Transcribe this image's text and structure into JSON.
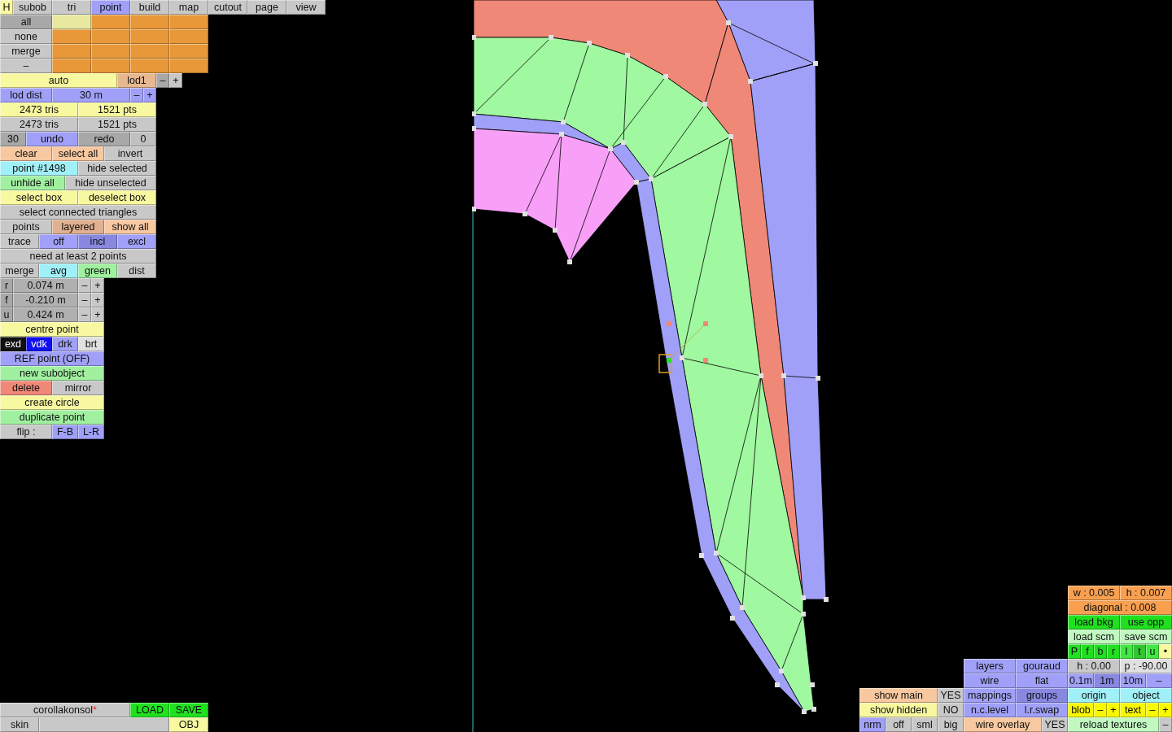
{
  "h_button": {
    "text": "H",
    "color": "#f8f8a0"
  },
  "tabs": [
    {
      "label": "subob",
      "selected": false
    },
    {
      "label": "tri",
      "selected": false
    },
    {
      "label": "point",
      "selected": true
    },
    {
      "label": "build",
      "selected": false
    },
    {
      "label": "map",
      "selected": false
    },
    {
      "label": "cutout",
      "selected": false
    },
    {
      "label": "page",
      "selected": false
    },
    {
      "label": "view",
      "selected": false
    }
  ],
  "left_rows": [
    [
      {
        "text": "all",
        "color": "#a8a8a8"
      },
      {
        "color": "#e8e8a0"
      },
      {
        "color": "#e89838"
      },
      {
        "color": "#e89838"
      },
      {
        "color": "#e89838"
      }
    ],
    [
      {
        "text": "none",
        "color": "#c8c8c8"
      },
      {
        "color": "#e89838"
      },
      {
        "color": "#e89838"
      },
      {
        "color": "#e89838"
      },
      {
        "color": "#e89838"
      }
    ],
    [
      {
        "text": "merge",
        "color": "#c8c8c8"
      },
      {
        "color": "#e89838"
      },
      {
        "color": "#e89838"
      },
      {
        "color": "#e89838"
      },
      {
        "color": "#e89838"
      }
    ],
    [
      {
        "text": "–",
        "color": "#c8c8c8"
      },
      {
        "color": "#e89838"
      },
      {
        "color": "#e89838"
      },
      {
        "color": "#e89838"
      },
      {
        "color": "#e89838"
      }
    ],
    [
      {
        "text": "auto",
        "color": "#f8f8a0"
      },
      {
        "text": "lod1",
        "color": "#e8b890"
      },
      {
        "text": "–",
        "color": "#a8a8a8"
      },
      {
        "text": "+",
        "color": "#c8c8c8"
      }
    ],
    [
      {
        "text": "lod dist",
        "color": "#a0a0f8"
      },
      {
        "text": "30 m",
        "color": "#a0a0f8"
      },
      {
        "text": "–",
        "color": "#a0a0f8"
      },
      {
        "text": "+",
        "color": "#a0a0f8"
      }
    ],
    [
      {
        "text": "2473 tris",
        "color": "#f8f8a0"
      },
      {
        "text": "1521 pts",
        "color": "#f8f8a0"
      }
    ],
    [
      {
        "text": "2473 tris",
        "color": "#c8c8c8"
      },
      {
        "text": "1521 pts",
        "color": "#c8c8c8"
      }
    ],
    [
      {
        "text": "30",
        "color": "#a8a8a8"
      },
      {
        "text": "undo",
        "color": "#a0a0f8"
      },
      {
        "text": "redo",
        "color": "#a8a8a8"
      },
      {
        "text": "0",
        "color": "#c0c0c0"
      }
    ],
    [
      {
        "text": "clear",
        "color": "#f8c8a0"
      },
      {
        "text": "select all",
        "color": "#f8c8a0"
      },
      {
        "text": "invert",
        "color": "#c8c8c8"
      }
    ],
    [
      {
        "text": "point #1498",
        "color": "#a0f0f8"
      },
      {
        "text": "hide selected",
        "color": "#c8c8c8"
      }
    ],
    [
      {
        "text": "unhide all",
        "color": "#a0f0a0"
      },
      {
        "text": "hide unselected",
        "color": "#c8c8c8"
      }
    ],
    [
      {
        "text": "select box",
        "color": "#f8f8a0"
      },
      {
        "text": "deselect box",
        "color": "#f8f8a0"
      }
    ],
    [
      {
        "text": "select connected triangles",
        "color": "#c8c8c8"
      }
    ],
    [
      {
        "text": "points",
        "color": "#c8c8c8"
      },
      {
        "text": "layered",
        "color": "#e0b090"
      },
      {
        "text": "show all",
        "color": "#f8c8a0"
      }
    ],
    [
      {
        "text": "trace",
        "color": "#c8c8c8"
      },
      {
        "text": "off",
        "color": "#a0a0f8"
      },
      {
        "text": "incl",
        "color": "#8888e0"
      },
      {
        "text": "excl",
        "color": "#a0a0f8"
      }
    ],
    [
      {
        "text": "need at least 2 points",
        "color": "#c8c8c8"
      }
    ],
    [
      {
        "text": "merge",
        "color": "#c8c8c8"
      },
      {
        "text": "avg",
        "color": "#a0f0f8"
      },
      {
        "text": "green",
        "color": "#a0f0a0"
      },
      {
        "text": "dist",
        "color": "#c8c8c8"
      }
    ],
    [
      {
        "text": "r",
        "color": "#a8a8a8"
      },
      {
        "text": "0.074 m",
        "color": "#b0b0b0"
      },
      {
        "text": "–",
        "color": "#c8c8c8"
      },
      {
        "text": "+",
        "color": "#c8c8c8"
      }
    ],
    [
      {
        "text": "f",
        "color": "#a8a8a8"
      },
      {
        "text": "-0.210 m",
        "color": "#b0b0b0"
      },
      {
        "text": "–",
        "color": "#c8c8c8"
      },
      {
        "text": "+",
        "color": "#c8c8c8"
      }
    ],
    [
      {
        "text": "u",
        "color": "#a8a8a8"
      },
      {
        "text": "0.424 m",
        "color": "#b0b0b0"
      },
      {
        "text": "–",
        "color": "#c8c8c8"
      },
      {
        "text": "+",
        "color": "#c8c8c8"
      }
    ],
    [
      {
        "text": "centre point",
        "color": "#f8f8a0"
      }
    ],
    [
      {
        "text": "exd",
        "color": "#101010"
      },
      {
        "text": "vdk",
        "color": "#1010f0"
      },
      {
        "text": "drk",
        "color": "#a0a0f8"
      },
      {
        "text": "brt",
        "color": "#e0e0e0"
      }
    ],
    [
      {
        "text": "REF point (OFF)",
        "color": "#a0a0f8"
      }
    ],
    [
      {
        "text": "new subobject",
        "color": "#a0f0a0"
      }
    ],
    [
      {
        "text": "delete",
        "color": "#f08878"
      },
      {
        "text": "mirror",
        "color": "#c8c8c8"
      }
    ],
    [
      {
        "text": "create circle",
        "color": "#f8f8a0"
      }
    ],
    [
      {
        "text": "duplicate point",
        "color": "#a0f0a0"
      }
    ],
    [
      {
        "text": "flip :",
        "color": "#c8c8c8"
      },
      {
        "text": "F-B",
        "color": "#a0a0f8"
      },
      {
        "text": "L-R",
        "color": "#a0a0f8"
      }
    ]
  ],
  "file_rows": [
    [
      {
        "text": "corollakonsol",
        "modified_mark": "*",
        "color": "#c8c8c8"
      },
      {
        "text": "LOAD",
        "color": "#20e020"
      },
      {
        "text": "SAVE",
        "color": "#20e020"
      }
    ],
    [
      {
        "text": "skin",
        "color": "#c8c8c8"
      },
      {
        "color": "#c8c8c8"
      },
      {
        "text": "OBJ",
        "color": "#f8f8a0"
      }
    ]
  ],
  "right_rows": [
    [
      {
        "text": "w : 0.005",
        "color": "#f8a050"
      },
      {
        "text": "h : 0.007",
        "color": "#f8a050"
      }
    ],
    [
      {
        "text": "diagonal : 0.008",
        "color": "#f8a050"
      }
    ],
    [
      {
        "text": "load bkg",
        "color": "#20e020"
      },
      {
        "text": "use opp",
        "color": "#20e020"
      }
    ],
    [
      {
        "text": "load scm",
        "color": "#c0f8c0"
      },
      {
        "text": "save scm",
        "color": "#c0f8c0"
      }
    ],
    [
      {
        "text": "P",
        "color": "#20e020"
      },
      {
        "text": "f",
        "color": "#20e020"
      },
      {
        "text": "b",
        "color": "#20e020"
      },
      {
        "text": "r",
        "color": "#20e020"
      },
      {
        "text": "l",
        "color": "#40e840"
      },
      {
        "text": "t",
        "color": "#30c830"
      },
      {
        "text": "u",
        "color": "#40e840"
      },
      {
        "text": "•",
        "color": "#f8f8a0"
      }
    ],
    [
      {
        "text": "layers",
        "color": "#a0a0f8"
      },
      {
        "text": "gouraud",
        "color": "#a0a0f8"
      },
      {
        "text": "h : 0.00",
        "color": "#c8c8c8"
      },
      {
        "text": "p : -90.00",
        "color": "#e0e0e0"
      }
    ],
    [
      {
        "text": "wire",
        "color": "#a0a0f8"
      },
      {
        "text": "flat",
        "color": "#a0a0f8"
      },
      {
        "text": "0.1m",
        "color": "#a0a0f8"
      },
      {
        "text": "1m",
        "color": "#8888e0"
      },
      {
        "text": "10m",
        "color": "#a0a0f8"
      },
      {
        "text": "–",
        "color": "#a0a0f8"
      }
    ],
    [
      {
        "text": "show main",
        "color": "#f8c8a0"
      },
      {
        "text": "YES",
        "color": "#c8c8c8"
      },
      {
        "text": "mappings",
        "color": "#a0a0f8"
      },
      {
        "text": "groups",
        "color": "#8888e0"
      },
      {
        "text": "origin",
        "color": "#a0f0f8"
      },
      {
        "text": "object",
        "color": "#a0f0f8"
      }
    ],
    [
      {
        "text": "show hidden",
        "color": "#f8f8a0"
      },
      {
        "text": "NO",
        "color": "#c8c8c8"
      },
      {
        "text": "n.c.level",
        "color": "#a0a0f8"
      },
      {
        "text": "l.r.swap",
        "color": "#a0a0f8"
      },
      {
        "text": "blob",
        "color": "#f8f800"
      },
      {
        "text": "–",
        "color": "#f8f800"
      },
      {
        "text": "+",
        "color": "#f8f800"
      },
      {
        "text": "text",
        "color": "#f8f800"
      },
      {
        "text": "–",
        "color": "#f8f800"
      },
      {
        "text": "+",
        "color": "#f8f800"
      }
    ],
    [
      {
        "text": "nrm",
        "color": "#a0a0f8"
      },
      {
        "text": "off",
        "color": "#c8c8c8"
      },
      {
        "text": "sml",
        "color": "#c8c8c8"
      },
      {
        "text": "big",
        "color": "#c8c8c8"
      },
      {
        "text": "wire overlay",
        "color": "#f8c8a0"
      },
      {
        "text": "YES",
        "color": "#c8c8c8"
      },
      {
        "text": "reload textures",
        "color": "#c0f8c0"
      },
      {
        "text": "–",
        "color": "#c8c8c8"
      }
    ]
  ]
}
